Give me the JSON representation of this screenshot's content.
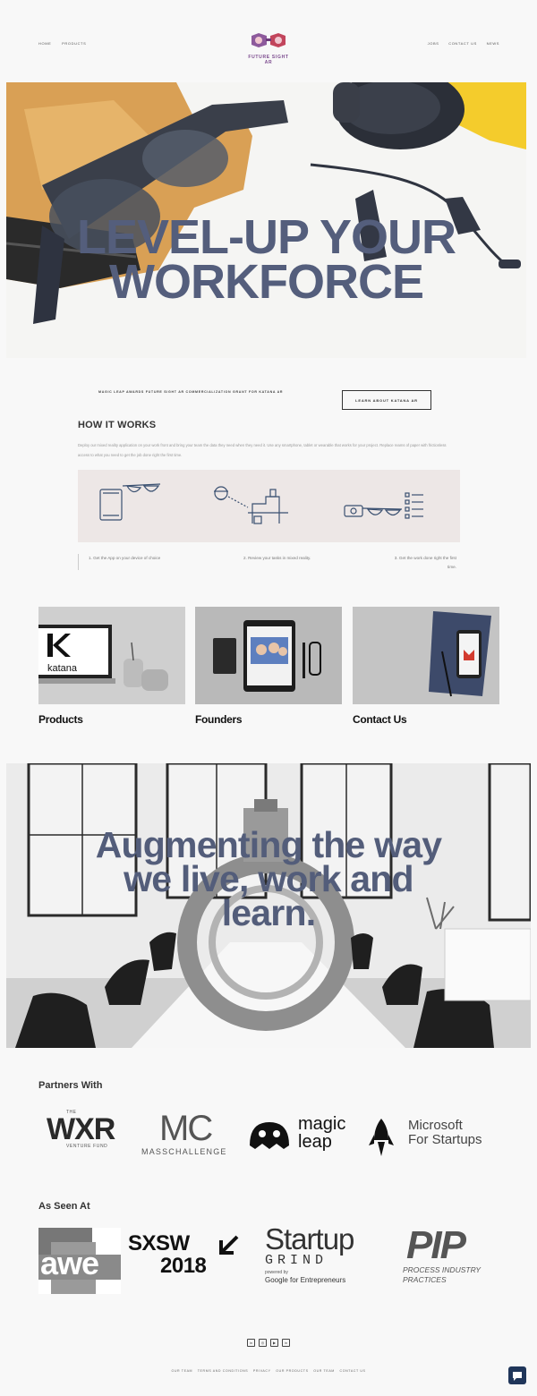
{
  "header": {
    "nav_left": [
      "Home",
      "Products"
    ],
    "nav_right": [
      "Jobs",
      "Contact Us",
      "News"
    ],
    "logo_text": "FUTURE SIGHT AR"
  },
  "hero": {
    "headline_line1": "LEVEL-UP YOUR",
    "headline_line2": "WORKFORCE"
  },
  "grant": {
    "text": "MAGIC LEAP AWARDS FUTURE SIGHT AR COMMERCIALIZATION GRANT FOR KATANA AR",
    "button_label": "LEARN ABOUT KATANA AR"
  },
  "how_it_works": {
    "title": "HOW IT WORKS",
    "description": "Deploy our mixed reality application on your work front and bring your team the data they need when they need it. Use any smartphone, tablet or wearable that works for your project. Replace reams of paper with frictionless access to what you need to get the job done right the first time.",
    "steps": [
      "1. Get the App on your device of choice",
      "2.  Review your tasks in mixed reality.",
      "3. Get the work done right the first time."
    ]
  },
  "cards": [
    {
      "title": "Products",
      "image_label": "katana"
    },
    {
      "title": "Founders"
    },
    {
      "title": "Contact Us"
    }
  ],
  "banner": {
    "headline_line1": "Augmenting the way",
    "headline_line2": "we live, work and",
    "headline_line3": "learn."
  },
  "partners": {
    "title": "Partners With",
    "items": [
      {
        "main": "WXR",
        "top": "THE",
        "sub": "VENTURE FUND"
      },
      {
        "main": "MC",
        "sub": "MASSCHALLENGE"
      },
      {
        "main": "magic",
        "main2": "leap"
      },
      {
        "main": "Microsoft",
        "main2": "For Startups"
      }
    ]
  },
  "seen_at": {
    "title": "As Seen At",
    "items": [
      {
        "main": "awe"
      },
      {
        "main": "SXSW",
        "main2": "2018"
      },
      {
        "main": "Startup",
        "main2": "GRIND",
        "sub1": "powered by",
        "sub2": "Google for Entrepreneurs"
      },
      {
        "main": "PIP",
        "sub1": "PROCESS INDUSTRY",
        "sub2": "PRACTICES"
      }
    ]
  },
  "footer": {
    "social_icons": [
      "linkedin-icon",
      "instagram-icon",
      "youtube-icon",
      "linkedin-icon"
    ],
    "links": [
      "Our Team",
      "Terms and Conditions",
      "Privacy",
      "Our Products",
      "Our Team",
      "Contact Us"
    ]
  },
  "colors": {
    "headline": "#545e7c",
    "chat_button": "#20365a",
    "steps_box": "#ede7e6",
    "logo": "#7b4a8d"
  }
}
